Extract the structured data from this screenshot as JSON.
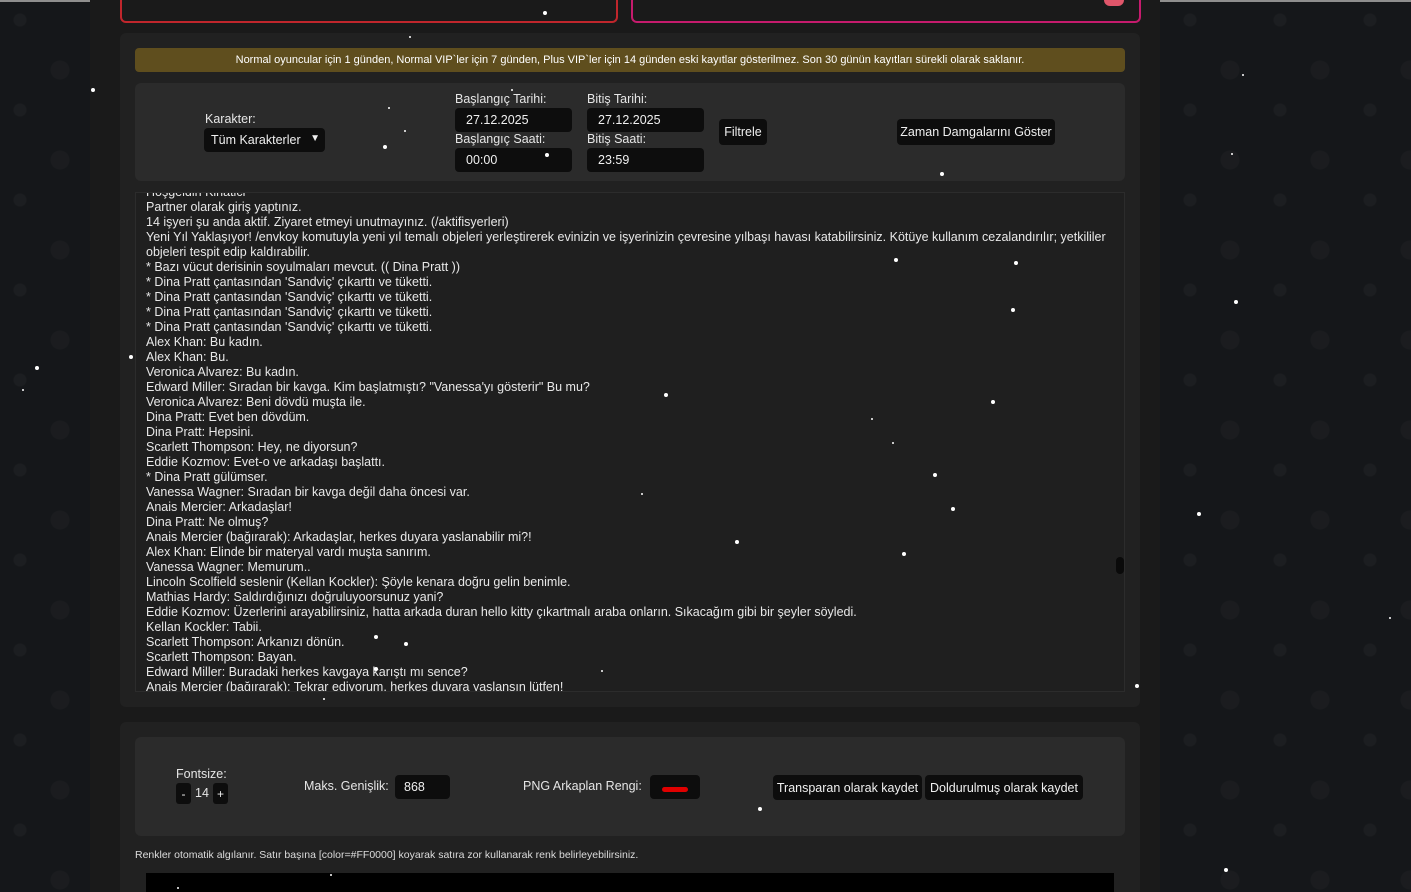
{
  "notice": "Normal oyuncular için 1 günden, Normal VIP`ler için 7 günden, Plus VIP`ler için 14 günden eski kayıtlar gösterilmez. Son 30 günün kayıtları sürekli olarak saklanır.",
  "filter": {
    "character_label": "Karakter:",
    "character_value": "Tüm Karakterler",
    "start_date_label": "Başlangıç Tarihi:",
    "start_date_value": "27.12.2025",
    "end_date_label": "Bitiş Tarihi:",
    "end_date_value": "27.12.2025",
    "start_time_label": "Başlangıç Saati:",
    "start_time_value": "00:00",
    "end_time_label": "Bitiş Saati:",
    "end_time_value": "23:59",
    "filter_button": "Filtrele",
    "timestamps_button": "Zaman Damgalarını Göster"
  },
  "log_lines": [
    "Hoşgeldin Kihatici",
    "Partner olarak giriş yaptınız.",
    "14 işyeri şu anda aktif. Ziyaret etmeyi unutmayınız. (/aktifisyerleri)",
    "Yeni Yıl Yaklaşıyor! /envkoy komutuyla yeni yıl temalı objeleri yerleştirerek evinizin ve işyerinizin çevresine yılbaşı havası katabilirsiniz. Kötüye kullanım cezalandırılır; yetkililer objeleri tespit edip kaldırabilir.",
    "* Bazı vücut derisinin soyulmaları mevcut. (( Dina Pratt ))",
    "* Dina Pratt çantasından 'Sandviç' çıkarttı ve tüketti.",
    "* Dina Pratt çantasından 'Sandviç' çıkarttı ve tüketti.",
    "* Dina Pratt çantasından 'Sandviç' çıkarttı ve tüketti.",
    "* Dina Pratt çantasından 'Sandviç' çıkarttı ve tüketti.",
    "Alex Khan: Bu kadın.",
    "Alex Khan: Bu.",
    "Veronica Alvarez: Bu kadın.",
    "Edward Miller: Sıradan bir kavga. Kim başlatmıştı? \"Vanessa'yı gösterir\" Bu mu?",
    "Veronica Alvarez: Beni dövdü muşta ile.",
    "Dina Pratt: Evet ben dövdüm.",
    "Dina Pratt: Hepsini.",
    "Scarlett Thompson: Hey, ne diyorsun?",
    "Eddie Kozmov: Evet-o ve arkadaşı başlattı.",
    "* Dina Pratt gülümser.",
    "Vanessa Wagner: Sıradan bir kavga değil daha öncesi var.",
    "Anais Mercier: Arkadaşlar!",
    "Dina Pratt: Ne olmuş?",
    "Anais Mercier (bağırarak): Arkadaşlar, herkes duyara yaslanabilir mi?!",
    "Alex Khan: Elinde bir materyal vardı muşta sanırım.",
    "Vanessa Wagner: Memurum..",
    "Lincoln Scolfield seslenir (Kellan Kockler): Şöyle kenara doğru gelin benimle.",
    "Mathias Hardy: Saldırdığınızı doğruluyoorsunuz yani?",
    "Eddie Kozmov: Üzerlerini arayabilirsiniz, hatta arkada duran hello kitty çıkartmalı araba onların. Sıkacağım gibi bir şeyler söyledi.",
    "Kellan Kockler: Tabii.",
    "Scarlett Thompson: Arkanızı dönün.",
    "Scarlett Thompson: Bayan.",
    "Edward Miller: Buradaki herkes kavgaya karıştı mı sence?",
    "Anais Mercier (bağırarak): Tekrar ediyorum, herkes duyara yaslansın lütfen!"
  ],
  "export": {
    "fontsize_label": "Fontsize:",
    "fontsize_minus": "-",
    "fontsize_value": "14",
    "fontsize_plus": "+",
    "max_width_label": "Maks. Genişlik:",
    "max_width_value": "868",
    "png_bg_label": "PNG Arkaplan Rengi:",
    "png_bg_color": "#e00000",
    "save_transparent": "Transparan olarak kaydet",
    "save_filled": "Doldurulmuş olarak kaydet"
  },
  "hint": "Renkler otomatik algılanır. Satır başına [color=#FF0000] koyarak satıra zor kullanarak renk belirleyebilirsiniz."
}
